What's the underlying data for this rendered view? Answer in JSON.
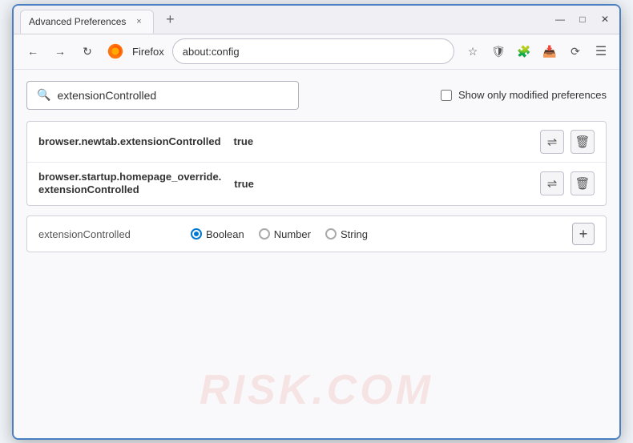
{
  "window": {
    "title": "Advanced Preferences",
    "tab_close": "×",
    "new_tab": "+",
    "minimize": "—",
    "maximize": "□",
    "close": "✕"
  },
  "navbar": {
    "back_label": "←",
    "forward_label": "→",
    "reload_label": "↻",
    "browser_name": "Firefox",
    "address": "about:config",
    "star_icon": "☆",
    "shield_icon": "🛡",
    "extension_icon": "🧩",
    "download_icon": "📥",
    "sync_icon": "⟳",
    "menu_icon": "☰"
  },
  "search": {
    "placeholder": "extensionControlled",
    "value": "extensionControlled",
    "checkbox_label": "Show only modified preferences"
  },
  "results": [
    {
      "name": "browser.newtab.extensionControlled",
      "value": "true",
      "multiline": false
    },
    {
      "name_line1": "browser.startup.homepage_override.",
      "name_line2": "extensionControlled",
      "value": "true",
      "multiline": true
    }
  ],
  "new_pref": {
    "name": "extensionControlled",
    "types": [
      {
        "label": "Boolean",
        "selected": true
      },
      {
        "label": "Number",
        "selected": false
      },
      {
        "label": "String",
        "selected": false
      }
    ],
    "add_btn": "+"
  },
  "watermark": "RISK.COM"
}
